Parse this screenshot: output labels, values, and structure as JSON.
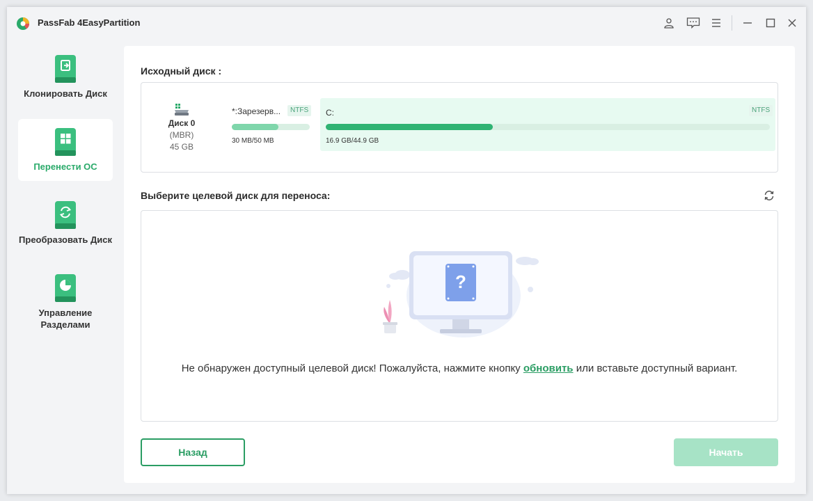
{
  "app": {
    "title": "PassFab 4EasyPartition",
    "accent_color": "#2aaa6a",
    "titlebar_icons": [
      "user-icon",
      "feedback-icon",
      "menu-icon",
      "minimize-icon",
      "maximize-icon",
      "close-icon"
    ]
  },
  "sidebar": {
    "items": [
      {
        "label": "Клонировать Диск",
        "icon": "clone-disk-icon",
        "active": false
      },
      {
        "label": "Перенести ОС",
        "icon": "migrate-os-icon",
        "active": true
      },
      {
        "label": "Преобразовать Диск",
        "icon": "convert-disk-icon",
        "active": false
      },
      {
        "label": "Управление\nРазделами",
        "label_line1": "Управление",
        "label_line2": "Разделами",
        "icon": "partition-manage-icon",
        "active": false
      }
    ]
  },
  "source": {
    "heading": "Исходный диск :",
    "disk": {
      "name": "Диск 0",
      "type": "(MBR)",
      "size": "45 GB",
      "icon": "disk-icon"
    },
    "partitions": [
      {
        "name": "*:Зарезерв...",
        "fs": "NTFS",
        "usage": "30 MB/50 MB",
        "used_fraction": 0.6
      },
      {
        "name": "C:",
        "fs": "NTFS",
        "usage": "16.9 GB/44.9 GB",
        "used_fraction": 0.376
      }
    ]
  },
  "target": {
    "heading": "Выберите целевой диск для переноса:",
    "refresh_icon": "refresh-icon",
    "empty_message_before": "Не обнаружен доступный целевой диск! Пожалуйста, нажмите кнопку ",
    "refresh_link": "обновить",
    "empty_message_after": " или вставьте доступный вариант."
  },
  "footer": {
    "back_label": "Назад",
    "start_label": "Начать"
  }
}
